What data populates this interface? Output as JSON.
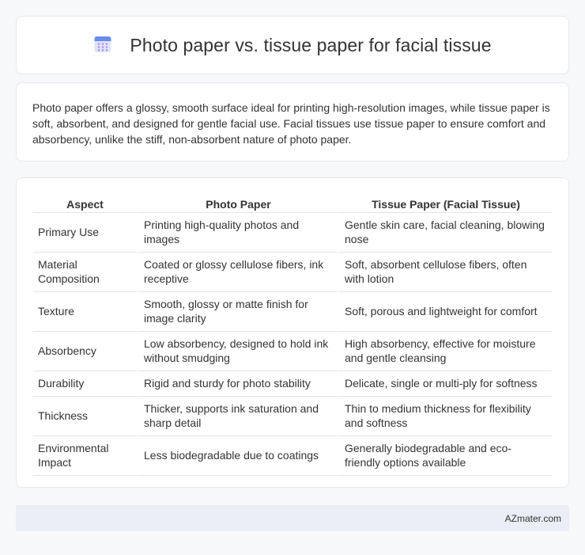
{
  "header": {
    "title": "Photo paper vs. tissue paper for facial tissue",
    "icon": "calendar-grid-icon",
    "icon_colors": {
      "top": "#6a8cf0",
      "body": "#dfe5fb",
      "dots": "#b393e8"
    }
  },
  "intro": {
    "text": "Photo paper offers a glossy, smooth surface ideal for printing high-resolution images, while tissue paper is soft, absorbent, and designed for gentle facial use. Facial tissues use tissue paper to ensure comfort and absorbency, unlike the stiff, non-absorbent nature of photo paper."
  },
  "table": {
    "headers": [
      "Aspect",
      "Photo Paper",
      "Tissue Paper (Facial Tissue)"
    ],
    "rows": [
      [
        "Primary Use",
        "Printing high-quality photos and images",
        "Gentle skin care, facial cleaning, blowing nose"
      ],
      [
        "Material Composition",
        "Coated or glossy cellulose fibers, ink receptive",
        "Soft, absorbent cellulose fibers, often with lotion"
      ],
      [
        "Texture",
        "Smooth, glossy or matte finish for image clarity",
        "Soft, porous and lightweight for comfort"
      ],
      [
        "Absorbency",
        "Low absorbency, designed to hold ink without smudging",
        "High absorbency, effective for moisture and gentle cleansing"
      ],
      [
        "Durability",
        "Rigid and sturdy for photo stability",
        "Delicate, single or multi-ply for softness"
      ],
      [
        "Thickness",
        "Thicker, supports ink saturation and sharp detail",
        "Thin to medium thickness for flexibility and softness"
      ],
      [
        "Environmental Impact",
        "Less biodegradable due to coatings",
        "Generally biodegradable and eco-friendly options available"
      ]
    ]
  },
  "footer": {
    "text": "AZmater.com"
  }
}
